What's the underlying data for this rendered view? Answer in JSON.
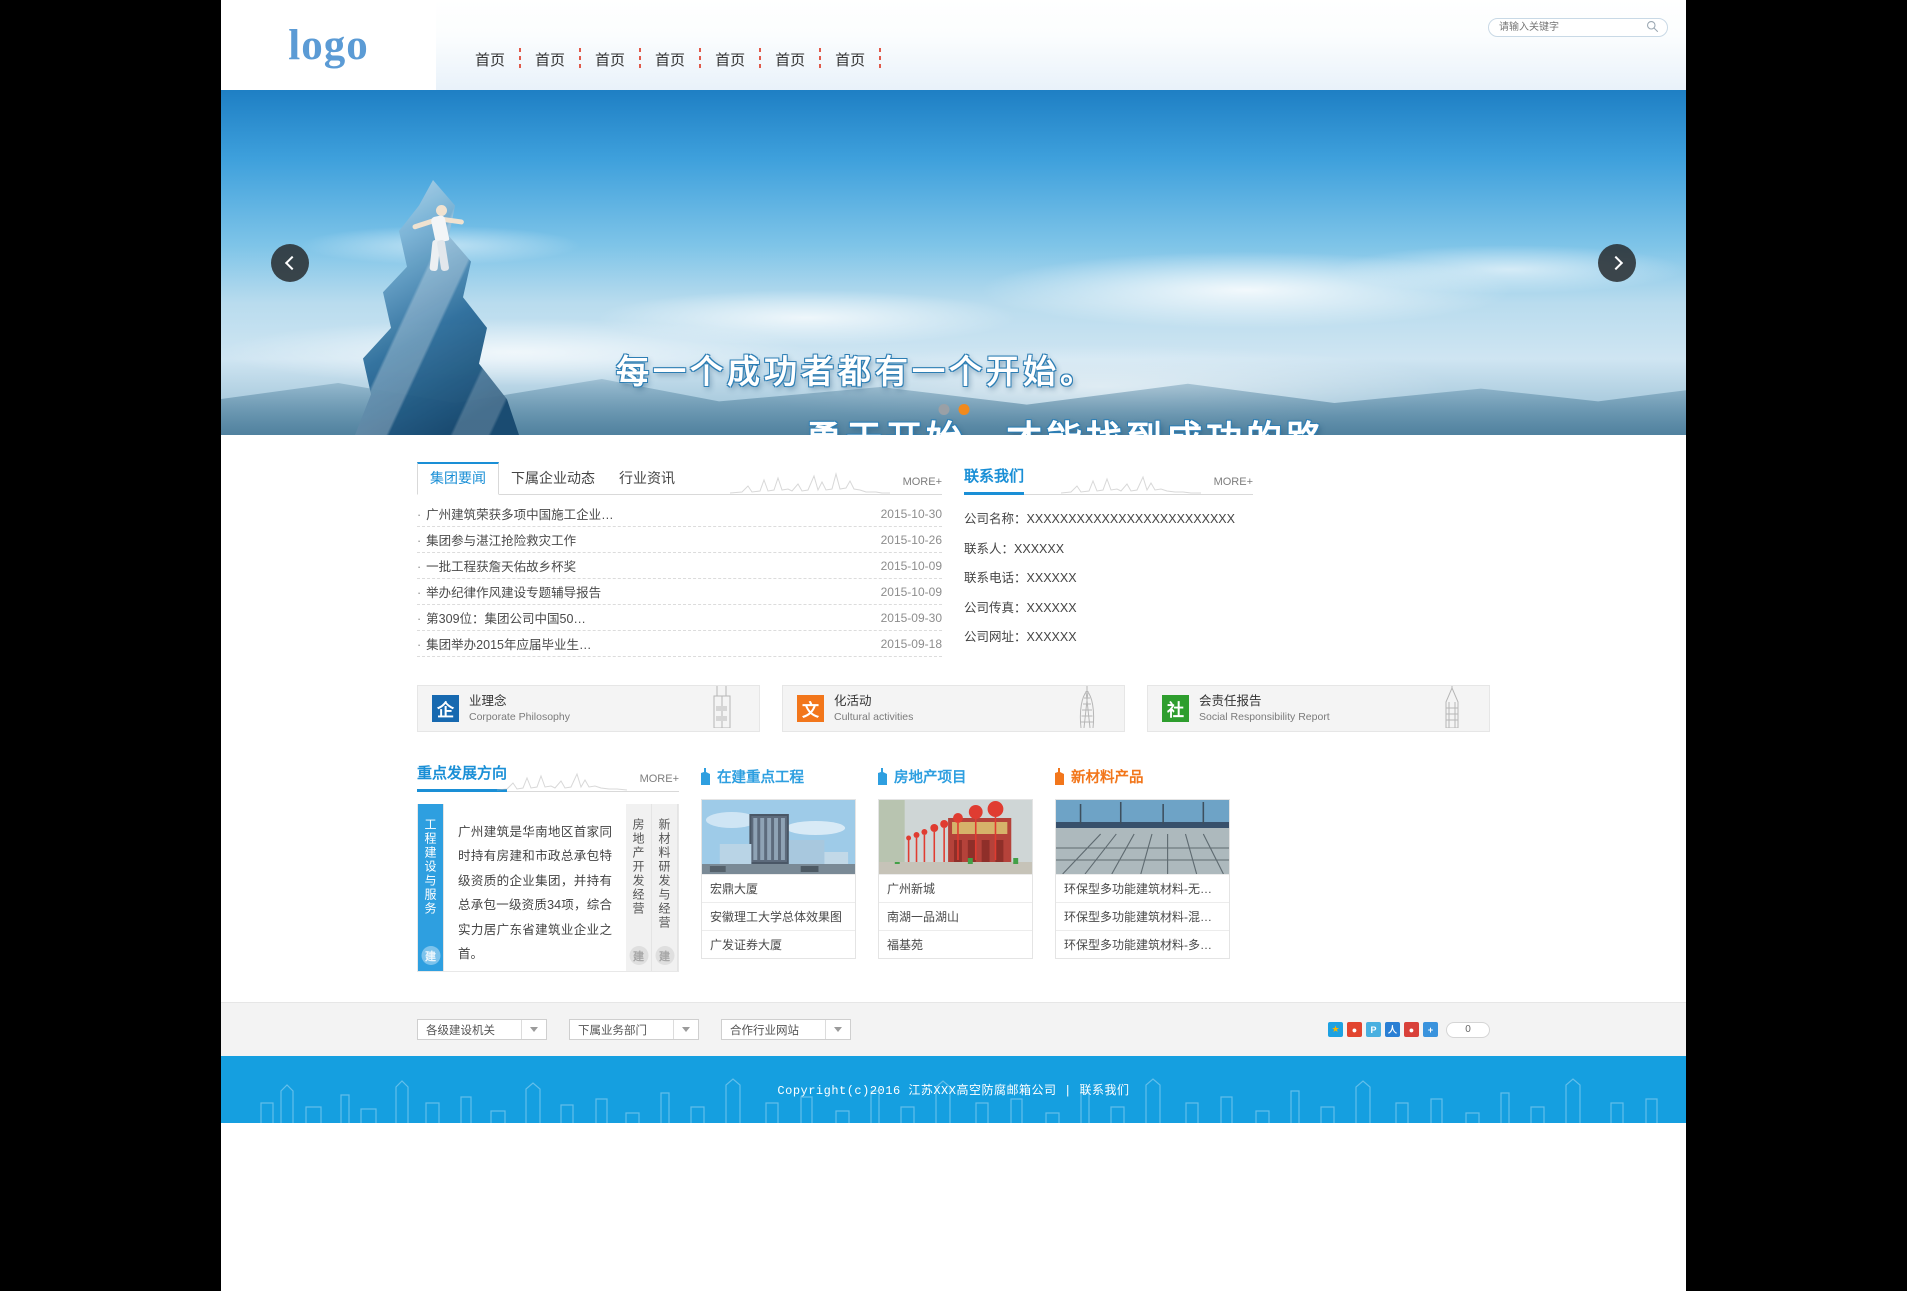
{
  "header": {
    "logo_text": "logo",
    "nav_items": [
      "首页",
      "首页",
      "首页",
      "首页",
      "首页",
      "首页",
      "首页"
    ],
    "search_placeholder": "请输入关键字",
    "search_value": ""
  },
  "hero": {
    "headline": "每一个成功者都有一个开始。",
    "subline": "勇于开始，才能找到成功的路。",
    "prev_label": "上一张",
    "next_label": "下一张",
    "dots": [
      "inactive",
      "active"
    ],
    "active_color": "#f18a1d"
  },
  "news": {
    "tabs": [
      {
        "label": "集团要闻",
        "active": true
      },
      {
        "label": "下属企业动态",
        "active": false
      },
      {
        "label": "行业资讯",
        "active": false
      }
    ],
    "more_label": "MORE+",
    "items": [
      {
        "title": "广州建筑荣获多项中国施工企业…",
        "date": "2015-10-30"
      },
      {
        "title": "集团参与湛江抢险救灾工作",
        "date": "2015-10-26"
      },
      {
        "title": "一批工程获詹天佑故乡杯奖",
        "date": "2015-10-09"
      },
      {
        "title": "举办纪律作风建设专题辅导报告",
        "date": "2015-10-09"
      },
      {
        "title": "第309位：集团公司中国50…",
        "date": "2015-09-30"
      },
      {
        "title": "集团举办2015年应届毕业生…",
        "date": "2015-09-18"
      }
    ]
  },
  "contact": {
    "title": "联系我们",
    "more_label": "MORE+",
    "items": [
      {
        "label": "公司名称：",
        "value": "XXXXXXXXXXXXXXXXXXXXXXXXX"
      },
      {
        "label": "联系人：",
        "value": "XXXXXX"
      },
      {
        "label": "联系电话：",
        "value": "XXXXXX"
      },
      {
        "label": "公司传真：",
        "value": "XXXXXX"
      },
      {
        "label": "公司网址：",
        "value": "XXXXXX"
      }
    ]
  },
  "features": [
    {
      "badge": "企",
      "badge_color": "#1769b0",
      "cn": "业理念",
      "en": "Corporate Philosophy"
    },
    {
      "badge": "文",
      "badge_color": "#f2761b",
      "cn": "化活动",
      "en": "Cultural activities"
    },
    {
      "badge": "社",
      "badge_color": "#2e9e2e",
      "cn": "会责任报告",
      "en": "Social Responsibility Report"
    }
  ],
  "development": {
    "title": "重点发展方向",
    "more_label": "MORE+",
    "tabs": [
      {
        "label": "工程建设与服务",
        "active": true
      },
      {
        "label": "房地产开发经营",
        "active": false
      },
      {
        "label": "新材料研发与经营",
        "active": false
      }
    ],
    "body": "广州建筑是华南地区首家同时持有房建和市政总承包特级资质的企业集团，并持有总承包一级资质34项，综合实力居广东省建筑业企业之首。",
    "logo_glyph": "建"
  },
  "projects": [
    {
      "title": "在建重点工程",
      "color": "#2e9fe0",
      "items": [
        "宏鼎大厦",
        "安徽理工大学总体效果图",
        "广发证券大厦"
      ]
    },
    {
      "title": "房地产项目",
      "color": "#2e9fe0",
      "items": [
        "广州新城",
        "南湖一品湖山",
        "福基苑"
      ]
    },
    {
      "title": "新材料产品",
      "color": "#f2761b",
      "items": [
        "环保型多功能建筑材料-无…",
        "环保型多功能建筑材料-混…",
        "环保型多功能建筑材料-多…"
      ]
    }
  ],
  "footer": {
    "selects": [
      "各级建设机关",
      "下属业务部门",
      "合作行业网站"
    ],
    "share_icons": [
      {
        "name": "qzone-icon",
        "glyph": "★",
        "color": "#f7b500",
        "bg": "#1da1e2"
      },
      {
        "name": "weibo-icon",
        "glyph": "●",
        "color": "#ffffff",
        "bg": "#e2452f"
      },
      {
        "name": "tencent-weibo-icon",
        "glyph": "P",
        "color": "#ffffff",
        "bg": "#49b0e0"
      },
      {
        "name": "renren-icon",
        "glyph": "人",
        "color": "#ffffff",
        "bg": "#2a7fd4"
      },
      {
        "name": "douban-icon",
        "glyph": "●",
        "color": "#ffffff",
        "bg": "#d9413a"
      },
      {
        "name": "share-more-icon",
        "glyph": "+",
        "color": "#ffffff",
        "bg": "#3a93dd"
      }
    ],
    "share_count": "0",
    "copyright": "Copyright(c)2016  江苏XXX高空防腐邮箱公司  |  联系我们"
  }
}
